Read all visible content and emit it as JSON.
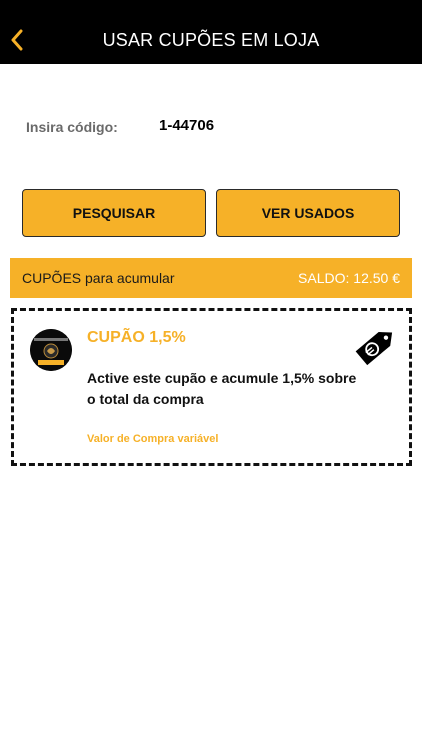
{
  "header": {
    "title": "USAR CUPÕES EM LOJA",
    "back_icon": "chevron-left-icon",
    "accent_color": "#f6b128"
  },
  "code": {
    "label": "Insira código:",
    "value": "1-44706"
  },
  "buttons": {
    "search_label": "PESQUISAR",
    "used_label": "VER USADOS"
  },
  "section": {
    "title": "CUPÕES para acumular",
    "balance": "SALDO: 12.50 €"
  },
  "coupon": {
    "name": "CUPÃO 1,5%",
    "description": "Active este cupão e acumule 1,5% sobre o total da compra",
    "value_note": "Valor de Compra variável",
    "icon": "euro-tag-icon"
  }
}
